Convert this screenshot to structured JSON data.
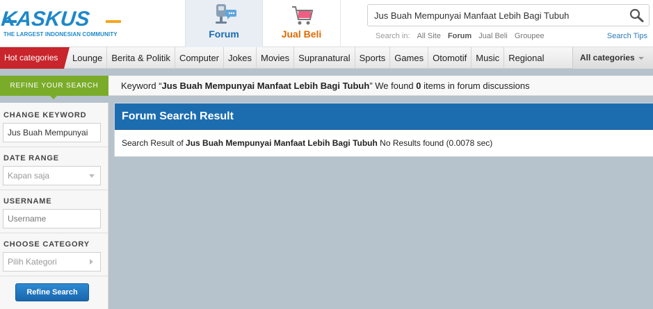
{
  "brand": {
    "logo_text": "KASKUS",
    "tagline": "THE LARGEST INDONESIAN COMMUNITY",
    "primary_color": "#1d88c9",
    "accent_color": "#f5a623"
  },
  "nav": {
    "forum_label": "Forum",
    "forum_icon": "forum-icon",
    "jual_beli_label": "Jual Beli",
    "jual_beli_icon": "shopping-cart-icon"
  },
  "search": {
    "value": "Jus Buah Mempunyai Manfaat Lebih Bagi Tubuh",
    "search_in_label": "Search in:",
    "scopes": [
      "All Site",
      "Forum",
      "Jual Beli",
      "Groupee"
    ],
    "active_scope": "Forum",
    "tips_label": "Search Tips"
  },
  "categories": {
    "hot_label": "Hot categories",
    "items": [
      "Lounge",
      "Berita & Politik",
      "Computer",
      "Jokes",
      "Movies",
      "Supranatural",
      "Sports",
      "Games",
      "Otomotif",
      "Music",
      "Regional"
    ],
    "all_label": "All categories",
    "hot_color": "#c8252c"
  },
  "refine": {
    "tag_label": "REFINE YOUR SEARCH",
    "keyword_prefix": "Keyword “",
    "keyword": "Jus Buah Mempunyai Manfaat Lebih Bagi Tubuh",
    "keyword_mid": "” We found ",
    "count": "0",
    "keyword_suffix": " items in forum discussions"
  },
  "sidebar": {
    "change_keyword_label": "CHANGE KEYWORD",
    "keyword_value": "Jus Buah Mempunyai",
    "date_range_label": "DATE RANGE",
    "date_range_value": "Kapan saja",
    "username_label": "USERNAME",
    "username_placeholder": "Username",
    "category_label": "CHOOSE CATEGORY",
    "category_value": "Pilih Kategori",
    "refine_button": "Refine Search"
  },
  "result": {
    "title": "Forum Search Result",
    "prefix": "Search Result of ",
    "keyword": "Jus Buah Mempunyai Manfaat Lebih Bagi Tubuh",
    "suffix": " No Results found (0.0078 sec)"
  }
}
